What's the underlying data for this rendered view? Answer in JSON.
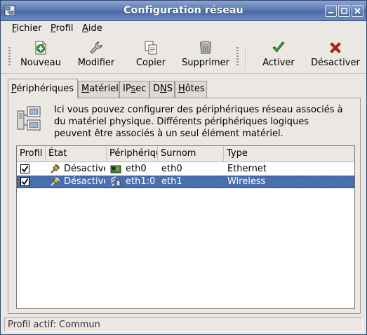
{
  "window": {
    "title": "Configuration réseau"
  },
  "menubar": {
    "items": [
      {
        "mnemonic": "F",
        "rest": "ichier"
      },
      {
        "mnemonic": "P",
        "rest": "rofil"
      },
      {
        "mnemonic": "A",
        "rest": "ide"
      }
    ]
  },
  "toolbar": {
    "new_label": "Nouveau",
    "edit_label": "Modifier",
    "copy_label": "Copier",
    "delete_label": "Supprimer",
    "activate_label": "Activer",
    "deactivate_label": "Désactiver"
  },
  "tabs": [
    {
      "pre": "",
      "mnemonic": "P",
      "post": "ériphériques",
      "active": true
    },
    {
      "pre": "",
      "mnemonic": "M",
      "post": "atériel",
      "active": false
    },
    {
      "pre": "IP",
      "mnemonic": "s",
      "post": "ec",
      "active": false
    },
    {
      "pre": "D",
      "mnemonic": "N",
      "post": "S",
      "active": false
    },
    {
      "pre": "",
      "mnemonic": "H",
      "post": "ôtes",
      "active": false
    }
  ],
  "info": {
    "text": "Ici vous pouvez configurer des périphériques réseau associés à du matériel physique. Différents périphériques logiques peuvent être associés à un seul élément matériel."
  },
  "device_list": {
    "columns": [
      "Profil",
      "État",
      "Périphérique",
      "Surnom",
      "Type"
    ],
    "rows": [
      {
        "profile_checked": true,
        "state": "Désactivé",
        "device": "eth0",
        "nickname": "eth0",
        "type": "Ethernet",
        "selected": false
      },
      {
        "profile_checked": true,
        "state": "Désactivé",
        "device": "eth1:0",
        "nickname": "eth1",
        "type": "Wireless",
        "selected": true
      }
    ]
  },
  "statusbar": {
    "text": "Profil actif: Commun"
  },
  "colors": {
    "selection": "#4a6fae",
    "titlebar": "#5a79b0"
  }
}
